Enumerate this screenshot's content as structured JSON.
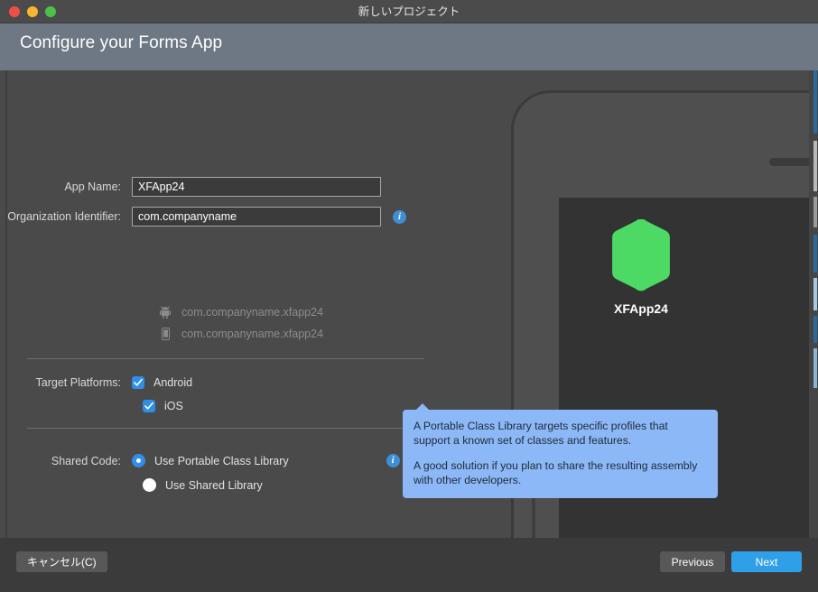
{
  "window": {
    "title": "新しいプロジェクト",
    "traffic_lights": [
      {
        "name": "close",
        "color": "#ef4f43"
      },
      {
        "name": "minimize",
        "color": "#f7b731"
      },
      {
        "name": "zoom",
        "color": "#4ec04a"
      }
    ]
  },
  "header": {
    "title": "Configure your Forms App",
    "background": "#6d7884"
  },
  "form": {
    "app_name": {
      "label": "App Name:",
      "value": "XFApp24",
      "placeholder": "App Name"
    },
    "organization_identifier": {
      "label": "Organization Identifier:",
      "value": "com.companyname",
      "placeholder": "com.companyname",
      "info_icon": "info-icon"
    },
    "bundle_previews": [
      {
        "platform_icon": "android-robot-icon",
        "text": "com.companyname.xfapp24"
      },
      {
        "platform_icon": "ios-phone-icon",
        "text": "com.companyname.xfapp24"
      }
    ],
    "target_platforms": {
      "label": "Target Platforms:",
      "options": [
        {
          "label": "Android",
          "checked": true
        },
        {
          "label": "iOS",
          "checked": true
        }
      ]
    },
    "shared_code": {
      "label": "Shared Code:",
      "info_icon": "info-icon",
      "options": [
        {
          "label": "Use Portable Class Library",
          "selected": true
        },
        {
          "label": "Use Shared Library",
          "selected": false
        }
      ]
    }
  },
  "tooltip": {
    "paragraph1": "A Portable Class Library targets specific profiles that support a known set of classes and features.",
    "paragraph2": "A good solution if you plan to share the resulting assembly with other developers.",
    "background": "#8cb8f7"
  },
  "preview": {
    "app_icon_label": "XFApp24",
    "app_icon_color": "#4cd964",
    "app_icon_shape": "hexagon"
  },
  "footer": {
    "cancel_label": "キャンセル(C)",
    "previous_label": "Previous",
    "next_label": "Next",
    "next_color": "#2f9fe8"
  }
}
